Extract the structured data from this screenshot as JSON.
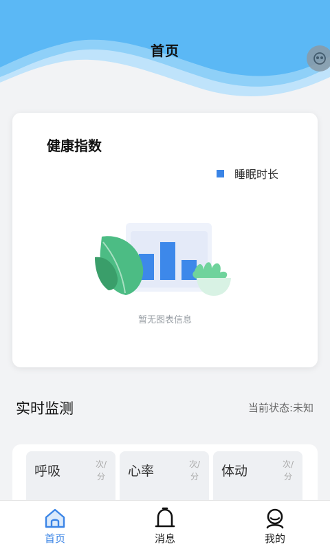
{
  "header": {
    "title": "首页"
  },
  "float_button": {
    "icon": "robot-face-icon"
  },
  "health_card": {
    "title": "健康指数",
    "legend": [
      {
        "label": "睡眠时长",
        "color": "#3a84e6"
      }
    ],
    "empty_text": "暂无图表信息"
  },
  "monitor": {
    "title": "实时监测",
    "status": "当前状态:未知",
    "metrics": [
      {
        "label": "呼吸",
        "unit_top": "次/",
        "unit_bottom": "分"
      },
      {
        "label": "心率",
        "unit_top": "次/",
        "unit_bottom": "分"
      },
      {
        "label": "体动",
        "unit_top": "次/",
        "unit_bottom": "分"
      }
    ]
  },
  "nav": {
    "items": [
      {
        "label": "首页",
        "icon": "home-icon",
        "active": true
      },
      {
        "label": "消息",
        "icon": "bell-icon",
        "active": false
      },
      {
        "label": "我的",
        "icon": "user-icon",
        "active": false
      }
    ]
  },
  "colors": {
    "accent": "#3a84e6",
    "header_wave": "#5bb8f5"
  }
}
